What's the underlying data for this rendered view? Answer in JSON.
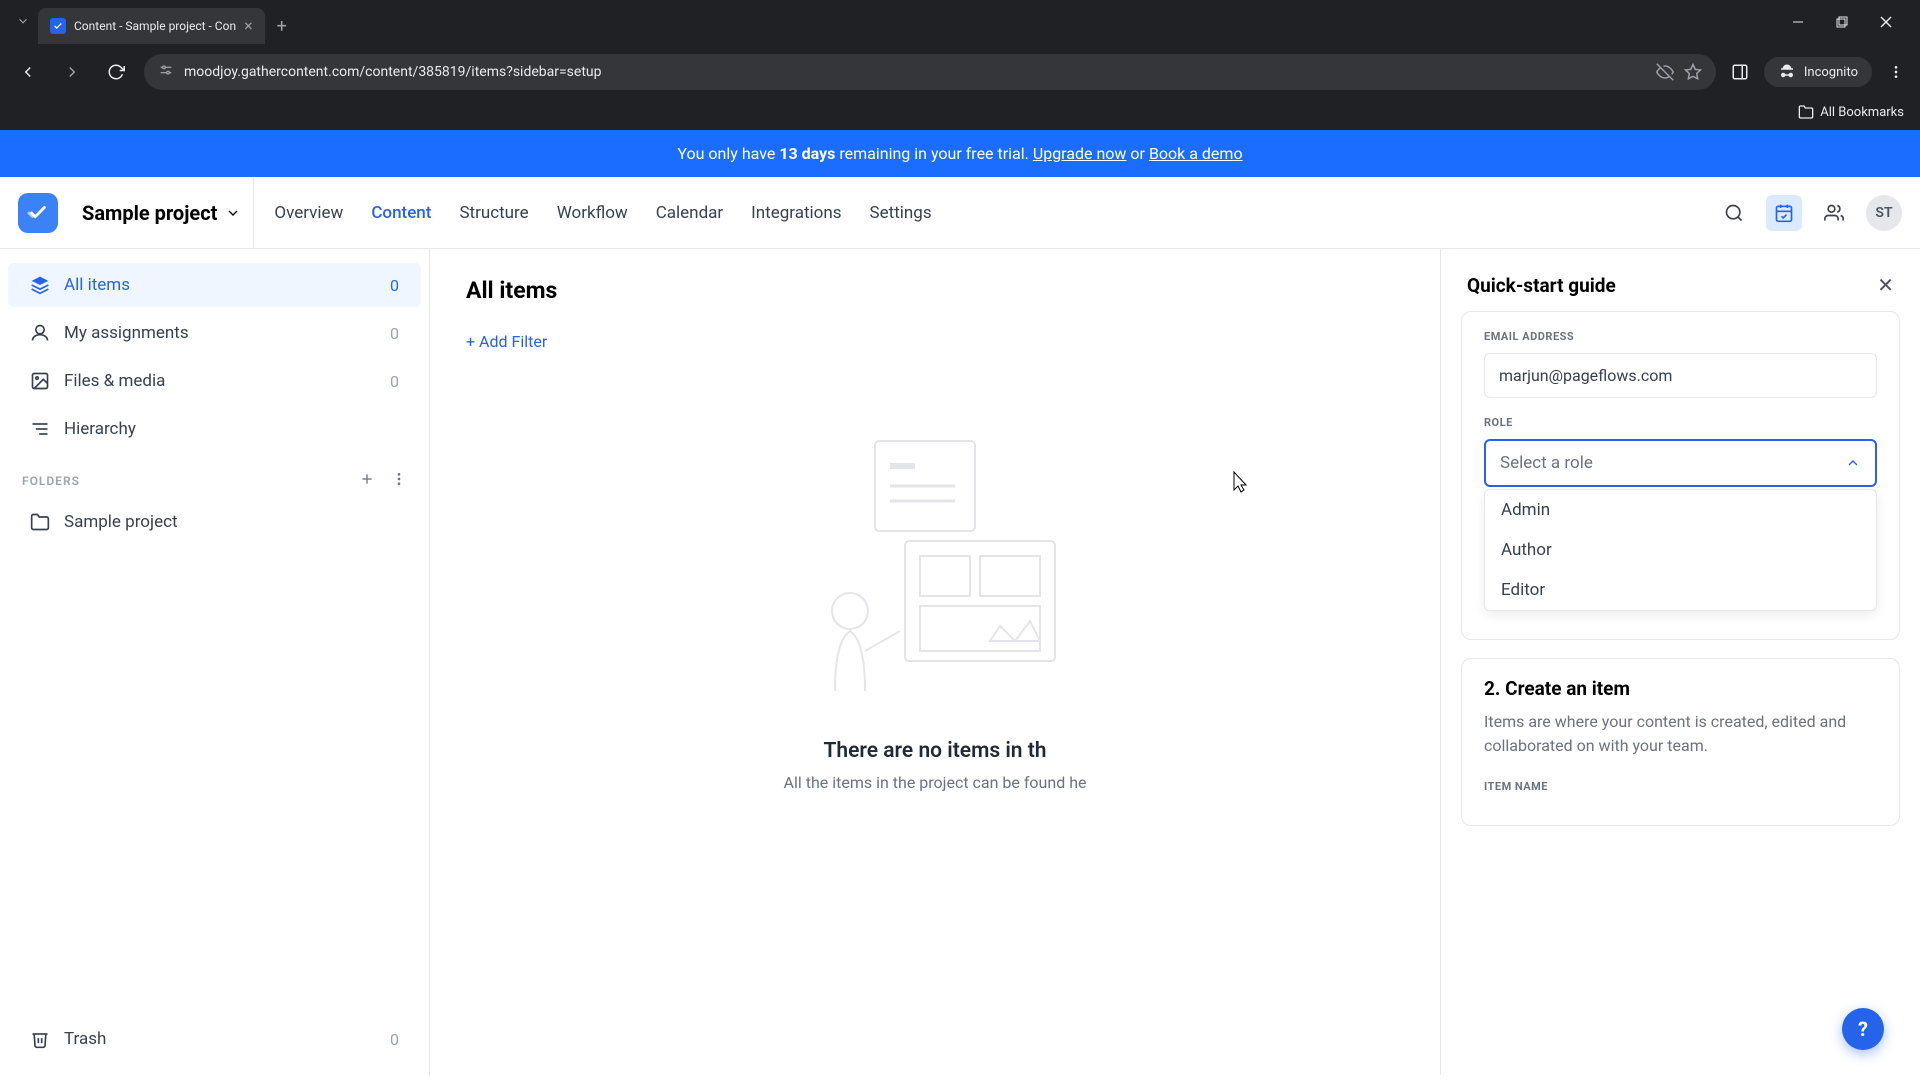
{
  "browser": {
    "tab_title": "Content - Sample project - Con",
    "url": "moodjoy.gathercontent.com/content/385819/items?sidebar=setup",
    "incognito_label": "Incognito",
    "all_bookmarks": "All Bookmarks"
  },
  "banner": {
    "prefix": "You only have ",
    "days": "13 days",
    "middle": " remaining in your free trial. ",
    "upgrade": "Upgrade now",
    "or": " or ",
    "demo": "Book a demo"
  },
  "header": {
    "project_name": "Sample project",
    "tabs": {
      "overview": "Overview",
      "content": "Content",
      "structure": "Structure",
      "workflow": "Workflow",
      "calendar": "Calendar",
      "integrations": "Integrations",
      "settings": "Settings"
    },
    "avatar": "ST"
  },
  "sidebar": {
    "all_items": {
      "label": "All items",
      "count": "0"
    },
    "assignments": {
      "label": "My assignments",
      "count": "0"
    },
    "files": {
      "label": "Files & media",
      "count": "0"
    },
    "hierarchy": {
      "label": "Hierarchy"
    },
    "folders_label": "FOLDERS",
    "folder_sample": "Sample project",
    "trash": {
      "label": "Trash",
      "count": "0"
    }
  },
  "content": {
    "title": "All items",
    "add_filter": "+ Add Filter",
    "empty_title": "There are no items in th",
    "empty_sub": "All the items in the project can be found he"
  },
  "panel": {
    "title": "Quick-start guide",
    "email_label": "EMAIL ADDRESS",
    "email_value": "marjun@pageflows.com",
    "role_label": "ROLE",
    "role_placeholder": "Select a role",
    "role_options": {
      "admin": "Admin",
      "author": "Author",
      "editor": "Editor"
    },
    "step2_title": "2. Create an item",
    "step2_desc": "Items are where your content is created, edited and collaborated on with your team.",
    "item_name_label": "ITEM NAME"
  },
  "help_fab": "?"
}
